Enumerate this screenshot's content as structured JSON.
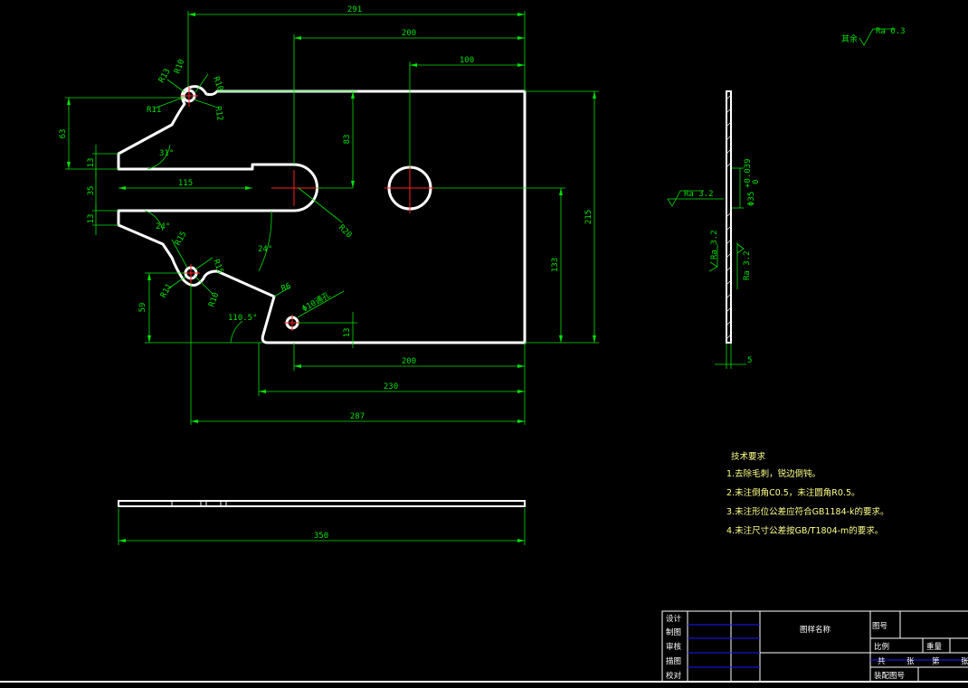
{
  "dimensions": {
    "d291": "291",
    "d200_top": "200",
    "d100": "100",
    "d63": "63",
    "d13_a": "13",
    "d35": "35",
    "d13_b": "13",
    "d115": "115",
    "d83": "83",
    "d31": "31°",
    "r20": "R20",
    "d24_a": "24°",
    "d24_b": "24°",
    "r15": "R15",
    "r15b": "R15",
    "d59": "59",
    "d11": "R11",
    "r10a": "R10",
    "r10b": "R10",
    "r11": "R11",
    "r12": "R12",
    "r13": "R13",
    "r6": "R6",
    "d110": "110.5°",
    "d133": "133",
    "d215": "215",
    "d13_c": "13",
    "d200_bot": "200",
    "d230": "230",
    "d287": "287",
    "d350": "350",
    "d5": "5",
    "hole": "Φ10通孔",
    "phi35": "Φ35",
    "phi35_tol": "+0.039",
    "phi35_tol2": "0",
    "ra32a": "Ra 3.2",
    "ra32b": "Ra 3.2",
    "ra32c": "Ra 3.2",
    "ra63": "Ra 6.3",
    "other": "其余"
  },
  "notes": {
    "title": "技术要求",
    "items": [
      "1.去除毛刺，锐边倒钝。",
      "2.未注倒角C0.5，未注圆角R0.5。",
      "3.未注形位公差应符合GB1184-k的要求。",
      "4.未注尺寸公差按GB/T1804-m的要求。"
    ]
  },
  "title_block": {
    "rows": [
      "设计",
      "制图",
      "审核",
      "描图",
      "校对"
    ],
    "drawing_name": "图样名称",
    "drawing_no": "图号",
    "scale": "比例",
    "weight": "重量",
    "total": "共",
    "sheet_unit": "张",
    "sheet": "第",
    "sheet_unit2": "张",
    "assembly": "装配图号"
  },
  "colors": {
    "outline": "#ffffff",
    "dimension": "#00e000",
    "center": "#ff2020",
    "table_line": "#1a1aff",
    "note": "#ffff88"
  }
}
